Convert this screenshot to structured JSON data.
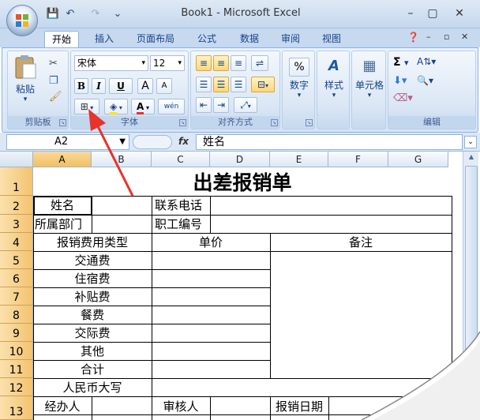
{
  "title_bar": {
    "title": "Book1 - Microsoft Excel",
    "minimize": "–",
    "restore": "▢",
    "close": "✕",
    "qat_save": "💾",
    "qat_undo": "↶",
    "qat_redo": "↷",
    "qat_more": "⌄"
  },
  "tabs": [
    {
      "label": "开始"
    },
    {
      "label": "插入"
    },
    {
      "label": "页面布局"
    },
    {
      "label": "公式"
    },
    {
      "label": "数据"
    },
    {
      "label": "审阅"
    },
    {
      "label": "视图"
    }
  ],
  "ribbon": {
    "clipboard": {
      "label": "剪贴板",
      "paste": "粘贴"
    },
    "font": {
      "label": "字体",
      "name": "宋体",
      "size": "12",
      "bold": "B",
      "italic": "I",
      "underline": "U",
      "grow": "A",
      "shrink": "A",
      "font_color": "A",
      "phonetic": "wén"
    },
    "alignment": {
      "label": "对齐方式"
    },
    "number": {
      "label": "数字",
      "symbol": "%"
    },
    "styles": {
      "label": "样式"
    },
    "cells": {
      "label": "单元格"
    },
    "editing": {
      "label": "编辑",
      "sum": "Σ"
    }
  },
  "formula_bar": {
    "name_box": "A2",
    "fx": "fx",
    "value": "姓名"
  },
  "columns": [
    "A",
    "B",
    "C",
    "D",
    "E",
    "F",
    "G"
  ],
  "rows": [
    "1",
    "2",
    "3",
    "4",
    "5",
    "6",
    "7",
    "8",
    "9",
    "10",
    "11",
    "12",
    "13"
  ],
  "sheet": {
    "title": "出差报销单",
    "name_label": "姓名",
    "phone_label": "联系电话",
    "dept_label": "所属部门",
    "emp_id_label": "职工编号",
    "expense_type_header": "报销费用类型",
    "unit_price_header": "单价",
    "notes_header": "备注",
    "expense_items": [
      "交通费",
      "住宿费",
      "补贴费",
      "餐费",
      "交际费",
      "其他",
      "合计"
    ],
    "rmb_label": "人民币大写",
    "handler_label": "经办人",
    "reviewer_label": "审核人",
    "date_label": "报销日期"
  },
  "colors": {
    "accent": "#15428b",
    "row_header": "#f3c36f",
    "arrow": "#e8322c"
  }
}
